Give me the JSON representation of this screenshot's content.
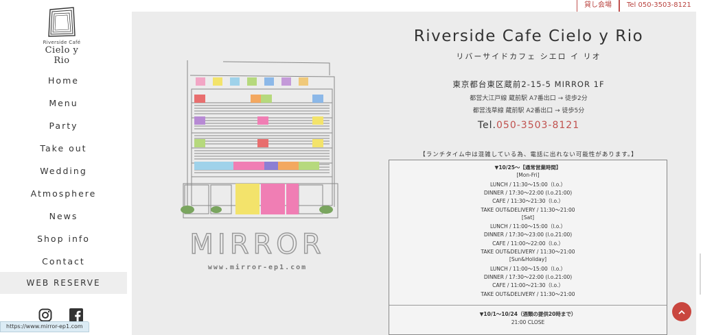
{
  "logo": {
    "small": "Riverside Café",
    "big": "Cielo y Rio"
  },
  "nav": [
    "Home",
    "Menu",
    "Party",
    "Take out",
    "Wedding",
    "Atmosphere",
    "News",
    "Shop info",
    "Contact"
  ],
  "reserve_label": "WEB RESERVE",
  "status_url": "https://www.mirror-ep1.com",
  "top_buttons": {
    "rental": "貸し会場",
    "tel": "Tel 050-3503-8121"
  },
  "illustration": {
    "mirror_text": "MIRROR",
    "url_text": "www.mirror-ep1.com"
  },
  "shop": {
    "title": "Riverside Cafe Cielo y Rio",
    "kana": "リバーサイドカフェ シエロ イ リオ",
    "address": "東京都台東区蔵前2-15-5 MIRROR 1F",
    "access1": "都営大江戸線 蔵前駅 A7番出口 → 徒歩2分",
    "access2": "都営浅草線 蔵前駅 A2番出口 → 徒歩5分",
    "tel_prefix": "Tel.",
    "tel_number": "050-3503-8121",
    "notice": "【ランチタイム中は混雑している為、電話に出れない可能性があります。】"
  },
  "hours": [
    "▼10/25～【通常営業時間】",
    "[Mon-Fri]",
    "LUNCH / 11:30～15:00（l.o.）",
    "DINNER / 17:30～22:00 (l.o.21:00)",
    "CAFE / 11:30～21:30（l.o.）",
    "TAKE OUT&DELIVERY / 11:30～21:00",
    "[Sat]",
    "LUNCH / 11:00～15:00（l.o.）",
    "DINNER / 17:30～23:00 (l.o.21:00)",
    "CAFE / 11:00～22:00（l.o.）",
    "TAKE OUT&DELIVERY / 11:30～21:00",
    "[Sun&Holiday]",
    "LUNCH / 11:00～15:00（l.o.）",
    "DINNER / 17:30～22:00 (l.o.21:00)",
    "CAFE / 11:00～21:30（l.o.）",
    "TAKE OUT&DELIVERY / 11:30～21:00"
  ],
  "hours2": [
    "▼10/1～10/24（酒類の提供20時まで）",
    "21:00 CLOSE"
  ],
  "icons": {
    "instagram": "instagram-icon",
    "facebook": "facebook-icon",
    "scroll_top": "chevron-up-icon"
  },
  "colors": {
    "accent": "#c0504d",
    "background": "#ececec"
  }
}
